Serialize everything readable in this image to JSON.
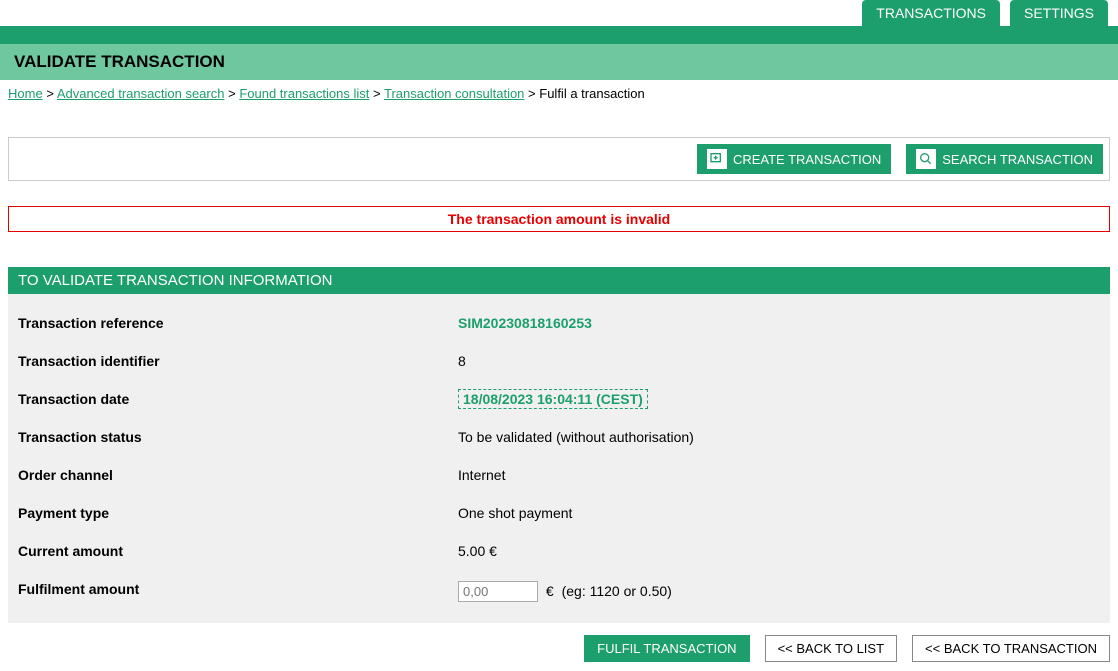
{
  "nav": {
    "transactions": "TRANSACTIONS",
    "settings": "SETTINGS"
  },
  "page_title": "VALIDATE TRANSACTION",
  "breadcrumb": {
    "home": "Home",
    "advanced_search": "Advanced transaction search",
    "found_list": "Found transactions list",
    "consultation": "Transaction consultation",
    "current": "Fulfil a transaction"
  },
  "actions": {
    "create": "CREATE TRANSACTION",
    "search": "SEARCH TRANSACTION"
  },
  "error_message": "The transaction amount is invalid",
  "section_header": "TO VALIDATE TRANSACTION INFORMATION",
  "fields": {
    "reference": {
      "label": "Transaction reference",
      "value": "SIM20230818160253"
    },
    "identifier": {
      "label": "Transaction identifier",
      "value": "8"
    },
    "date": {
      "label": "Transaction date",
      "value": "18/08/2023 16:04:11 (CEST)"
    },
    "status": {
      "label": "Transaction status",
      "value": "To be validated (without authorisation)"
    },
    "channel": {
      "label": "Order channel",
      "value": "Internet"
    },
    "payment_type": {
      "label": "Payment type",
      "value": "One shot payment"
    },
    "current_amount": {
      "label": "Current amount",
      "value": "5.00  €"
    },
    "fulfilment": {
      "label": "Fulfilment amount",
      "placeholder": "0,00",
      "currency": "€",
      "hint": "(eg: 1120 or 0.50)"
    }
  },
  "buttons": {
    "fulfil": "FULFIL TRANSACTION",
    "back_list": "<<  BACK TO LIST",
    "back_transaction": "<<  BACK TO TRANSACTION"
  }
}
